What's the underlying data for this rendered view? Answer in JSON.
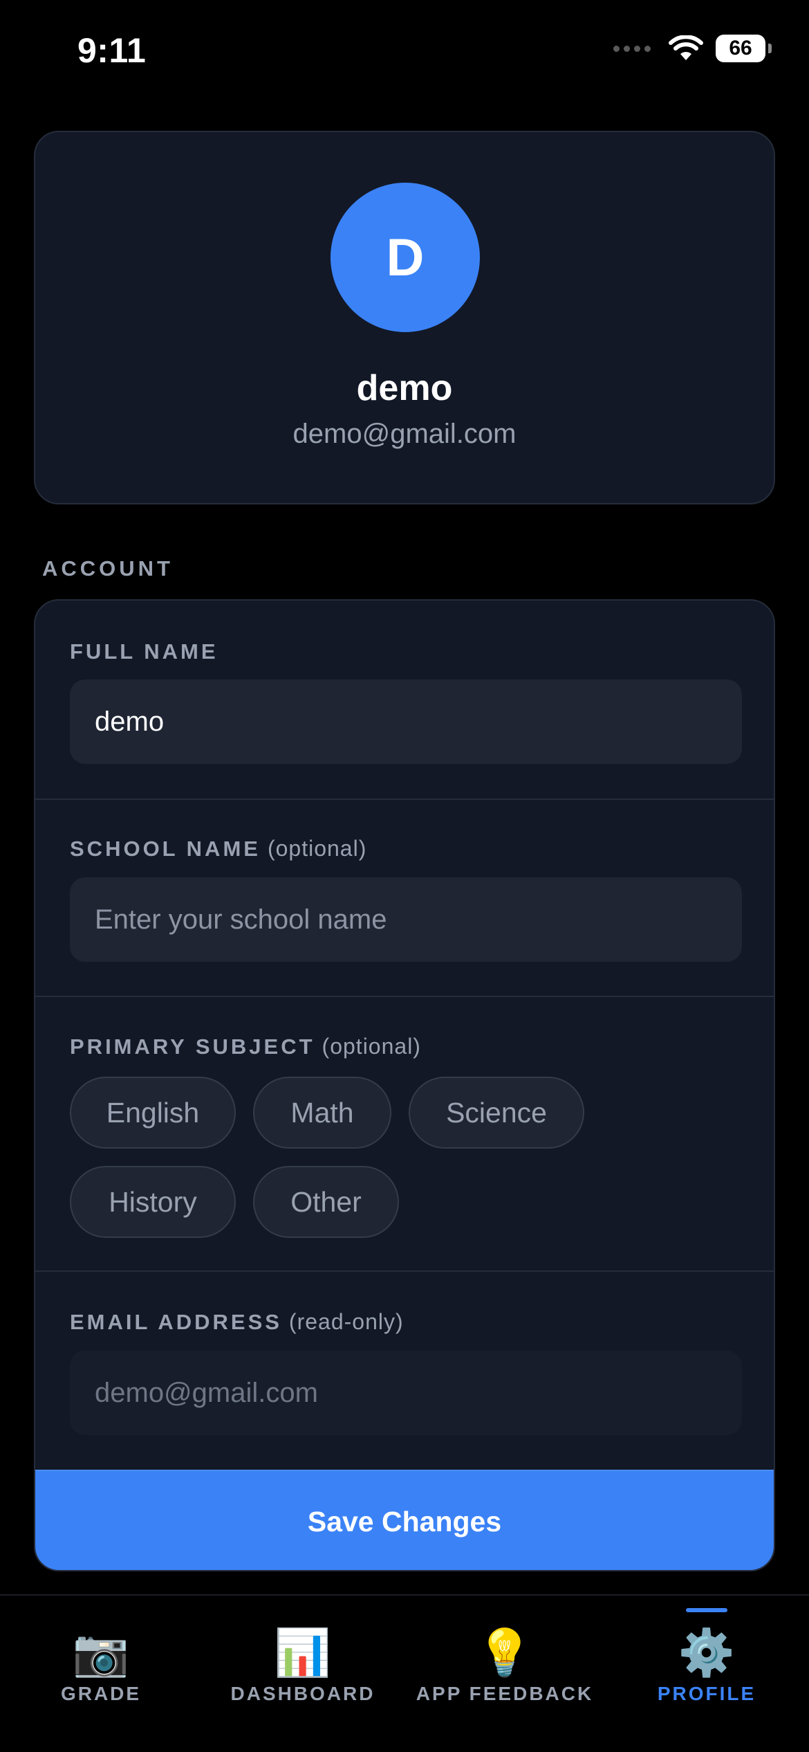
{
  "status_bar": {
    "time": "9:11",
    "battery": "66"
  },
  "profile": {
    "avatar_initial": "D",
    "name": "demo",
    "email": "demo@gmail.com"
  },
  "account": {
    "section_label": "ACCOUNT",
    "full_name": {
      "label": "FULL NAME",
      "value": "demo"
    },
    "school_name": {
      "label": "SCHOOL NAME",
      "hint": "(optional)",
      "placeholder": "Enter your school name"
    },
    "primary_subject": {
      "label": "PRIMARY SUBJECT",
      "hint": "(optional)",
      "options": [
        "English",
        "Math",
        "Science",
        "History",
        "Other"
      ]
    },
    "email": {
      "label": "EMAIL ADDRESS",
      "hint": "(read-only)",
      "value": "demo@gmail.com"
    },
    "save_label": "Save Changes"
  },
  "nav": {
    "items": [
      {
        "label": "GRADE",
        "icon": "camera-icon"
      },
      {
        "label": "DASHBOARD",
        "icon": "bar-chart-icon"
      },
      {
        "label": "APP FEEDBACK",
        "icon": "lightbulb-icon"
      },
      {
        "label": "PROFILE",
        "icon": "gear-icon"
      }
    ],
    "active": "PROFILE"
  },
  "colors": {
    "accent": "#3b82f6",
    "card": "#121826",
    "input": "#1f2533",
    "muted": "#9aa2b1"
  }
}
